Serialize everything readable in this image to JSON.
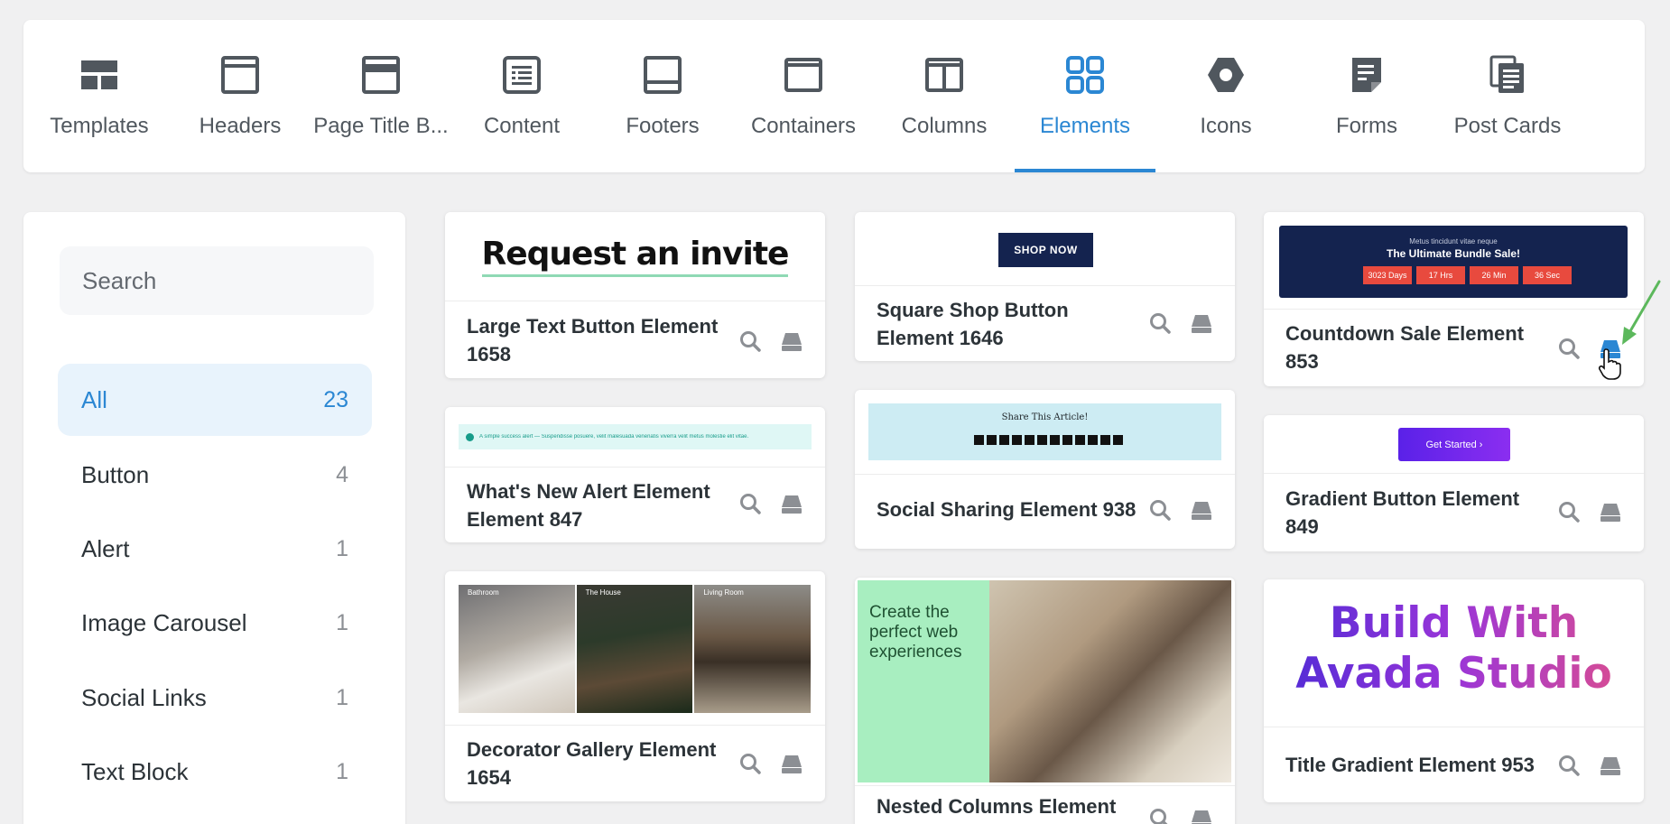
{
  "tabs": [
    {
      "label": "Templates",
      "icon": "templates-icon"
    },
    {
      "label": "Headers",
      "icon": "headers-icon"
    },
    {
      "label": "Page Title B...",
      "icon": "page-title-bar-icon"
    },
    {
      "label": "Content",
      "icon": "content-icon"
    },
    {
      "label": "Footers",
      "icon": "footers-icon"
    },
    {
      "label": "Containers",
      "icon": "containers-icon"
    },
    {
      "label": "Columns",
      "icon": "columns-icon"
    },
    {
      "label": "Elements",
      "icon": "elements-icon",
      "active": true
    },
    {
      "label": "Icons",
      "icon": "icons-icon"
    },
    {
      "label": "Forms",
      "icon": "forms-icon"
    },
    {
      "label": "Post Cards",
      "icon": "post-cards-icon"
    }
  ],
  "colors": {
    "accent": "#2b87d3",
    "active_bg": "#e8f3fc"
  },
  "sidebar": {
    "search_placeholder": "Search",
    "categories": [
      {
        "label": "All",
        "count": "23",
        "active": true
      },
      {
        "label": "Button",
        "count": "4"
      },
      {
        "label": "Alert",
        "count": "1"
      },
      {
        "label": "Image Carousel",
        "count": "1"
      },
      {
        "label": "Social Links",
        "count": "1"
      },
      {
        "label": "Text Block",
        "count": "1"
      }
    ]
  },
  "cards": {
    "large_text_button": {
      "title": "Large Text Button Element 1658",
      "preview_text": "Request an invite"
    },
    "square_shop_button": {
      "title": "Square Shop Button Element 1646",
      "preview_text": "SHOP NOW"
    },
    "countdown_sale": {
      "title": "Countdown Sale Element 853",
      "preview_small": "Metus tincidunt vitae neque",
      "preview_big": "The Ultimate Bundle Sale!",
      "boxes": [
        "3023 Days",
        "17 Hrs",
        "26 Min",
        "36 Sec"
      ]
    },
    "whats_new_alert": {
      "title": "What's New Alert Element Element 847",
      "preview_text": "A simple success alert — Suspendisse posuere, velit malesuada venenatis viverra velit metus molestie elit vitae."
    },
    "social_sharing": {
      "title": "Social Sharing Element 938",
      "preview_text": "Share This Article!"
    },
    "gradient_button": {
      "title": "Gradient Button Element 849",
      "preview_text": "Get Started ›"
    },
    "decorator_gallery": {
      "title": "Decorator Gallery Element 1654",
      "labels": [
        "Bathroom",
        "The House",
        "Living Room"
      ]
    },
    "nested_columns": {
      "title": "Nested Columns Element",
      "preview_heading": "Create the perfect web experiences"
    },
    "title_gradient": {
      "title": "Title Gradient Element 953",
      "preview_line1": "Build With",
      "preview_line2": "Avada Studio"
    }
  }
}
